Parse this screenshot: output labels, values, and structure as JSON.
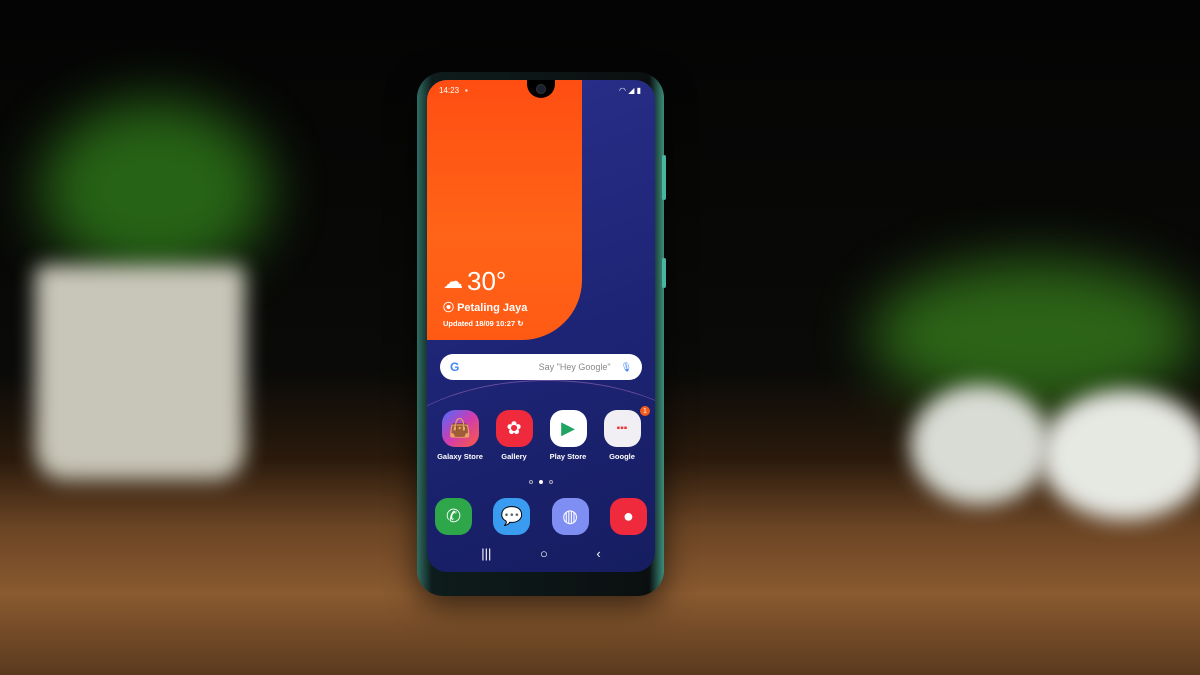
{
  "status_bar": {
    "time": "14:23",
    "icons": [
      "image-icon",
      "mute-icon",
      "wifi-icon",
      "signal-icon",
      "battery-icon"
    ]
  },
  "weather": {
    "temperature": "30°",
    "location": "Petaling Jaya",
    "updated": "Updated 18/09 10:27",
    "icon": "cloud-fog-icon"
  },
  "search": {
    "placeholder": "Say \"Hey Google\""
  },
  "apps": [
    {
      "label": "Galaxy Store",
      "icon": "shopping-bag-icon"
    },
    {
      "label": "Gallery",
      "icon": "flower-icon"
    },
    {
      "label": "Play Store",
      "icon": "play-triangle-icon"
    },
    {
      "label": "Google",
      "icon": "folder-icon",
      "badge": "1"
    }
  ],
  "dock": [
    {
      "icon": "phone-icon"
    },
    {
      "icon": "messages-icon"
    },
    {
      "icon": "internet-icon"
    },
    {
      "icon": "camera-icon"
    }
  ],
  "nav": {
    "recents": "|||",
    "home": "○",
    "back": "‹"
  },
  "colors": {
    "wallpaper_orange": "#ff5a14",
    "wallpaper_blue": "#1c2372",
    "phone_frame": "#3b8d7c"
  }
}
